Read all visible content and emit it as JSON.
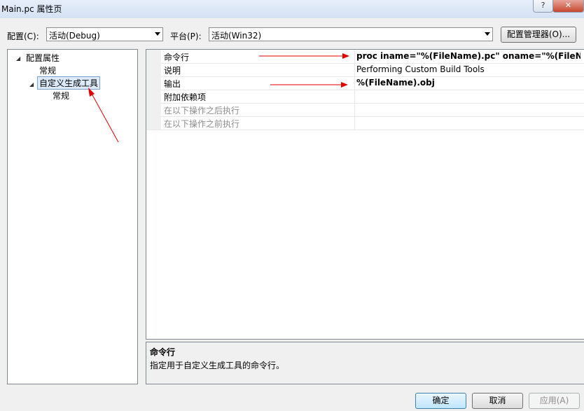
{
  "window": {
    "title": "Main.pc 属性页",
    "help": "?",
    "close": "✕"
  },
  "toolbar": {
    "config_label": "配置(C):",
    "config_value": "活动(Debug)",
    "platform_label": "平台(P):",
    "platform_value": "活动(Win32)",
    "config_manager": "配置管理器(O)..."
  },
  "tree": {
    "root": "配置属性",
    "general": "常规",
    "custom_build": "自定义生成工具",
    "custom_general": "常规"
  },
  "properties": [
    {
      "name": "命令行",
      "value": "proc iname=\"%(FileName).pc\" oname=\"%(FileName).c\" i"
    },
    {
      "name": "说明",
      "value": "Performing Custom Build Tools"
    },
    {
      "name": "输出",
      "value": " %(FileName).obj"
    },
    {
      "name": "附加依赖项",
      "value": ""
    },
    {
      "name": "在以下操作之后执行",
      "value": ""
    },
    {
      "name": "在以下操作之前执行",
      "value": ""
    }
  ],
  "description": {
    "title": "命令行",
    "text": "指定用于自定义生成工具的命令行。"
  },
  "buttons": {
    "ok": "确定",
    "cancel": "取消",
    "apply": "应用(A)"
  },
  "colors": {
    "annotation": "#e00000",
    "selection": "#dce9f8",
    "default_button": "#3c7fb1"
  }
}
